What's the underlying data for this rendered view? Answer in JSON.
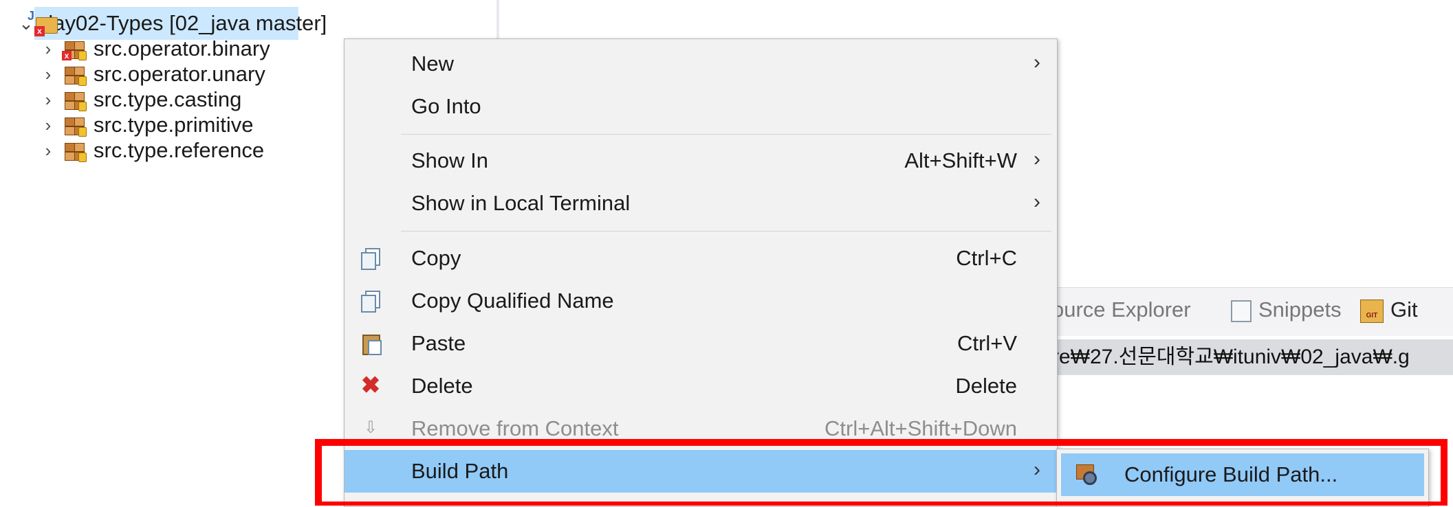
{
  "tree": {
    "project": {
      "label": "day02-Types [02_java master]"
    },
    "packages": [
      {
        "label": "src.operator.binary",
        "has_error": true
      },
      {
        "label": "src.operator.unary",
        "has_error": false
      },
      {
        "label": "src.type.casting",
        "has_error": false
      },
      {
        "label": "src.type.primitive",
        "has_error": false
      },
      {
        "label": "src.type.reference",
        "has_error": false
      }
    ]
  },
  "menu": {
    "items": [
      {
        "label": "New",
        "shortcut": "",
        "submenu": true
      },
      {
        "label": "Go Into",
        "shortcut": "",
        "submenu": false
      },
      {
        "label": "Show In",
        "shortcut": "Alt+Shift+W",
        "submenu": true
      },
      {
        "label": "Show in Local Terminal",
        "shortcut": "",
        "submenu": true
      },
      {
        "label": "Copy",
        "shortcut": "Ctrl+C",
        "icon": "copy-icon"
      },
      {
        "label": "Copy Qualified Name",
        "shortcut": "",
        "icon": "copy-qualified-name-icon"
      },
      {
        "label": "Paste",
        "shortcut": "Ctrl+V",
        "icon": "paste-icon"
      },
      {
        "label": "Delete",
        "shortcut": "Delete",
        "icon": "delete-icon"
      },
      {
        "label": "Remove from Context",
        "shortcut": "Ctrl+Alt+Shift+Down",
        "disabled": true,
        "icon": "remove-context-icon"
      },
      {
        "label": "Build Path",
        "shortcut": "",
        "submenu": true,
        "highlighted": true
      }
    ],
    "submenu": {
      "label": "Configure Build Path...",
      "icon": "configure-build-path-icon"
    }
  },
  "background_panel": {
    "tabs": [
      "ource Explorer",
      "Snippets",
      "Git"
    ],
    "path_text": "re₩27.선문대학교₩ituniv₩02_java₩.g"
  },
  "colors": {
    "selection": "#cce8ff",
    "menu_highlight": "#91c9f7",
    "annotation": "#ff0000"
  }
}
